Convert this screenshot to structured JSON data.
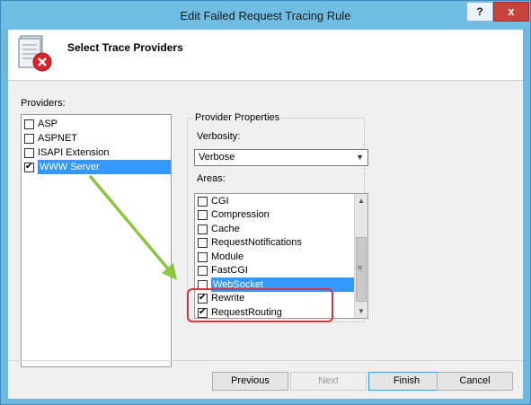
{
  "window": {
    "title": "Edit Failed Request Tracing Rule",
    "help_label": "?",
    "close_label": "x"
  },
  "header": {
    "title": "Select Trace Providers"
  },
  "providers": {
    "label": "Providers:",
    "items": [
      {
        "label": "ASP",
        "checked": false,
        "selected": false
      },
      {
        "label": "ASPNET",
        "checked": false,
        "selected": false
      },
      {
        "label": "ISAPI Extension",
        "checked": false,
        "selected": false
      },
      {
        "label": "WWW Server",
        "checked": true,
        "selected": true
      }
    ]
  },
  "properties": {
    "legend": "Provider Properties",
    "verbosity_label": "Verbosity:",
    "verbosity_value": "Verbose",
    "areas_label": "Areas:",
    "areas": [
      {
        "label": "CGI",
        "checked": false,
        "selected": false
      },
      {
        "label": "Compression",
        "checked": false,
        "selected": false
      },
      {
        "label": "Cache",
        "checked": false,
        "selected": false
      },
      {
        "label": "RequestNotifications",
        "checked": false,
        "selected": false
      },
      {
        "label": "Module",
        "checked": false,
        "selected": false
      },
      {
        "label": "FastCGI",
        "checked": false,
        "selected": false
      },
      {
        "label": "WebSocket",
        "checked": false,
        "selected": true
      },
      {
        "label": "Rewrite",
        "checked": true,
        "selected": false
      },
      {
        "label": "RequestRouting",
        "checked": true,
        "selected": false
      }
    ]
  },
  "buttons": {
    "previous": "Previous",
    "next": "Next",
    "finish": "Finish",
    "cancel": "Cancel"
  },
  "colors": {
    "selection": "#3399ff",
    "titlebar": "#70bde3",
    "close": "#c7423a",
    "annotation_box": "#e0303a",
    "annotation_arrow": "#8cc63f"
  }
}
